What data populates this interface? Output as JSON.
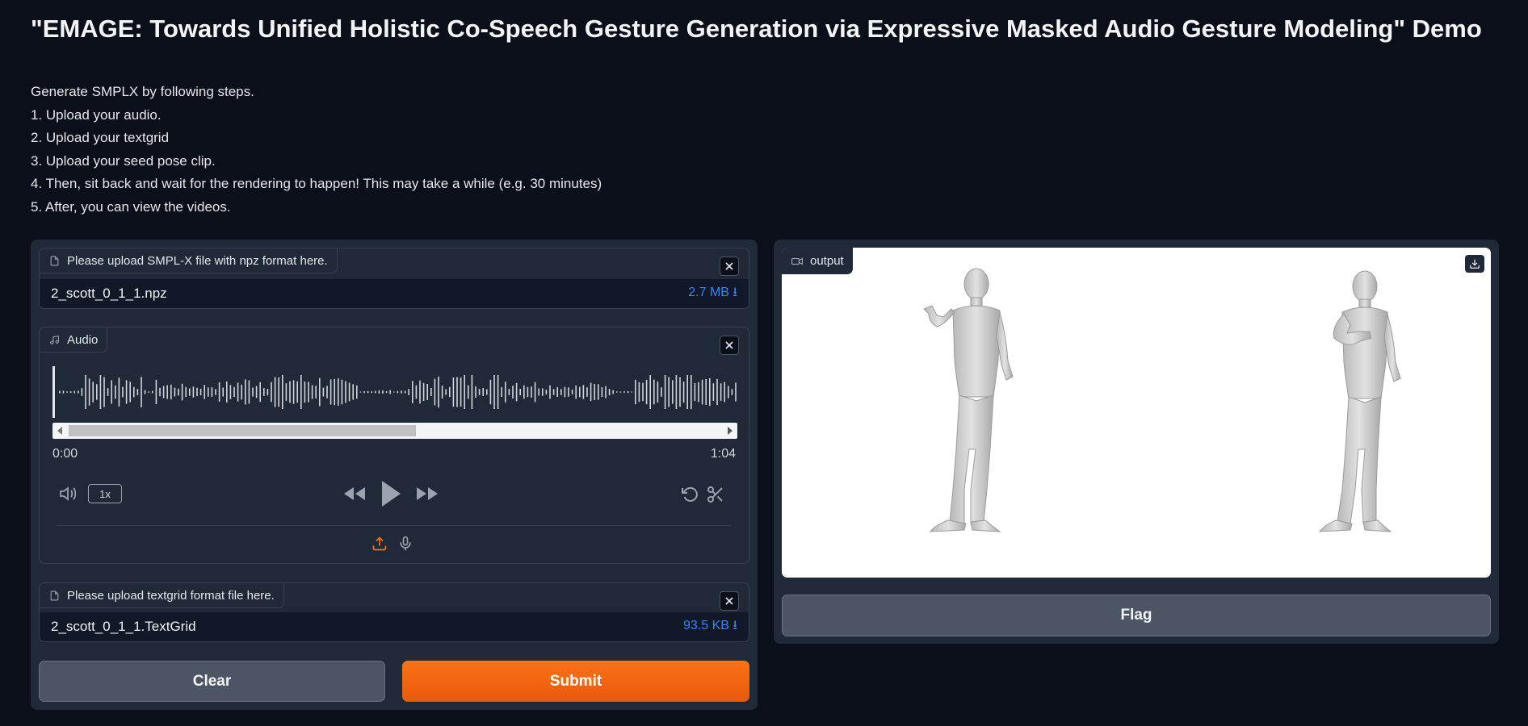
{
  "header": {
    "title": "\"EMAGE: Towards Unified Holistic Co-Speech Gesture Generation via Expressive Masked Audio Gesture Modeling\" Demo"
  },
  "instructions": [
    "Generate SMPLX by following steps.",
    "1. Upload your audio.",
    "2. Upload your textgrid",
    "3. Upload your seed pose clip.",
    "4. Then, sit back and wait for the rendering to happen! This may take a while (e.g. 30 minutes)",
    "5. After, you can view the videos."
  ],
  "smplx_upload": {
    "label": "Please upload SMPL-X file with npz format here.",
    "file_name": "2_scott_0_1_1.npz",
    "file_size": "2.7 MB ⭳"
  },
  "audio": {
    "label": "Audio",
    "current_time": "0:00",
    "duration": "1:04",
    "speed": "1x",
    "scroll_visible_fraction": 0.5
  },
  "textgrid_upload": {
    "label": "Please upload textgrid format file here.",
    "file_name": "2_scott_0_1_1.TextGrid",
    "file_size": "93.5 KB ⭳"
  },
  "buttons": {
    "clear": "Clear",
    "submit": "Submit",
    "flag": "Flag"
  },
  "output": {
    "label": "output"
  },
  "colors": {
    "background": "#0b0f19",
    "panel": "#1f2937",
    "accent": "#f97316",
    "file_size": "#3b82f6"
  }
}
